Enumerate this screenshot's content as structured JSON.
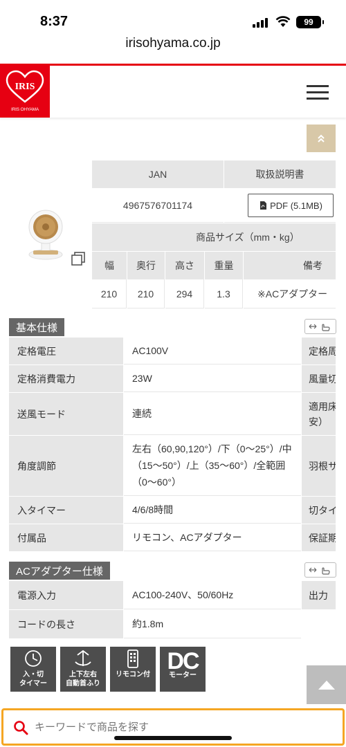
{
  "status": {
    "time": "8:37",
    "battery": "99"
  },
  "browser": {
    "url": "irisohyama.co.jp"
  },
  "brand": {
    "logo_small_text": "IRIS OHYAMA",
    "color": "#e60012"
  },
  "top_table": {
    "jan_header": "JAN",
    "manual_header": "取扱説明書",
    "jan_value": "4967576701174",
    "pdf_label": "PDF (5.1MB)",
    "size_header": "商品サイズ（mm・kg）",
    "columns": [
      "幅",
      "奥行",
      "高さ",
      "重量",
      "備考"
    ],
    "values": [
      "210",
      "210",
      "294",
      "1.3",
      "※ACアダプター"
    ]
  },
  "basic_spec": {
    "title": "基本仕様",
    "rows": [
      {
        "label": "定格電圧",
        "value": "AC100V",
        "extra": "定格周"
      },
      {
        "label": "定格消費電力",
        "value": "23W",
        "extra": "風量切"
      },
      {
        "label": "送風モード",
        "value": "連続",
        "extra": "適用床\n安）"
      },
      {
        "label": "角度調節",
        "value": "左右（60,90,120°）/下（0〜25°）/中（15〜50°）/上（35〜60°）/全範囲（0〜60°）",
        "extra": "羽根サ"
      },
      {
        "label": "入タイマー",
        "value": "4/6/8時間",
        "extra": "切タイ"
      },
      {
        "label": "付属品",
        "value": "リモコン、ACアダプター",
        "extra": "保証期"
      }
    ]
  },
  "adapter_spec": {
    "title": "ACアダプター仕様",
    "rows": [
      {
        "label": "電源入力",
        "value": "AC100-240V、50/60Hz",
        "extra": "出力"
      },
      {
        "label": "コードの長さ",
        "value": "約1.8m",
        "extra": ""
      }
    ]
  },
  "features": [
    {
      "line1": "入・切",
      "line2": "タイマー"
    },
    {
      "line1": "上下左右",
      "line2": "自動首ふり"
    },
    {
      "line1": "リモコン付",
      "line2": ""
    },
    {
      "big": "DC",
      "line1": "モーター"
    }
  ],
  "search": {
    "placeholder": "キーワードで商品を探す"
  }
}
